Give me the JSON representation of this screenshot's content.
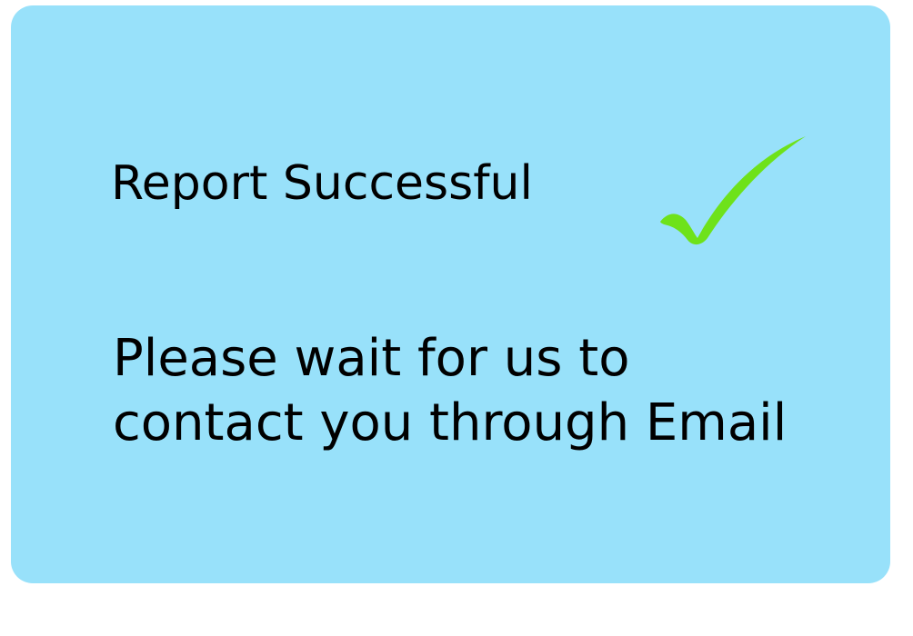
{
  "dialog": {
    "title": "Report Successful",
    "icon": "check-mark-icon",
    "message_lines": [
      "Please wait for us to",
      "contact you through Email"
    ]
  },
  "colors": {
    "card_background": "#98e1fa",
    "check_mark": "#6ee21a",
    "text": "#000000"
  }
}
